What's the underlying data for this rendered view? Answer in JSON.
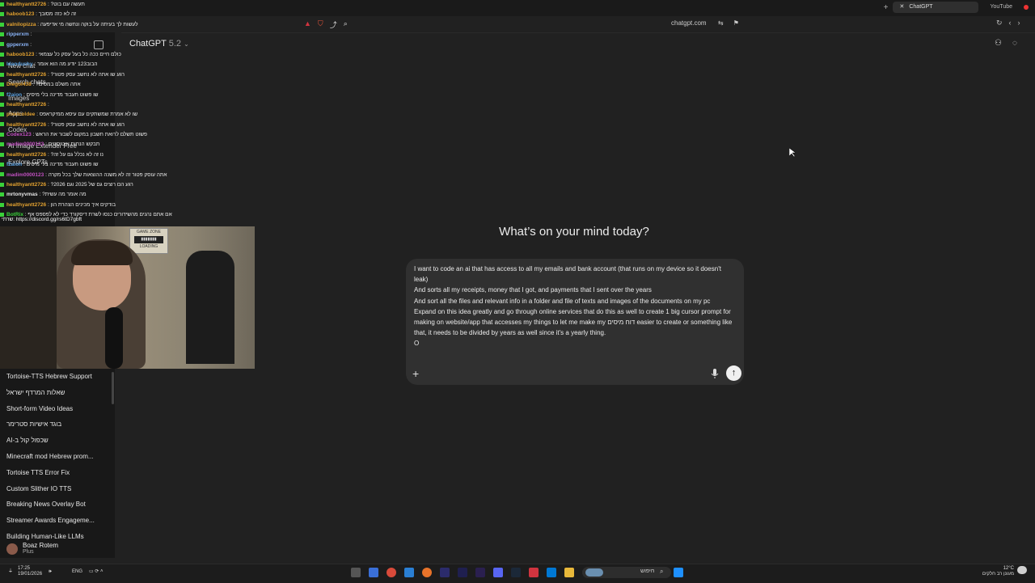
{
  "browser": {
    "tabs": [
      {
        "label": "ChatGPT",
        "active": true
      },
      {
        "label": "YouTube",
        "active": false
      }
    ],
    "url": "chatgpt.com"
  },
  "app": {
    "model_name": "ChatGPT",
    "model_version": "5.2"
  },
  "main": {
    "heading": "What’s on your mind today?",
    "composer_text": "I want to code an ai that has access to all my emails and bank account (that runs on my device so it doesn't leak)\nAnd sorts all my receipts, money that I got, and payments that I sent over the years\nAnd sort all the files and relevant info in a folder and file of texts and images of the documents on my pc\nExpand on this idea greatly and go through online services that do this as well to create 1 big cursor prompt for making on website/app that accesses my things to let me make my דוח מיסים easier to create or something like that, it needs to be divided by years as well since it's a yearly thing.\nO"
  },
  "sidebar": {
    "overlay_items": [
      "New chat",
      "Search chats",
      "Images",
      "Apps",
      "Codex",
      "AI Image Extender Free",
      "Explore GPTs"
    ],
    "chats": [
      "Tortoise-TTS Hebrew Support",
      "שאלות המרדף ישראל",
      "Short-form Video Ideas",
      "בוגד אישיות סטרימר",
      "שכפול קול ב-AI",
      "Minecraft mod Hebrew prom...",
      "Tortoise TTS Error Fix",
      "Custom Slither IO TTS",
      "Breaking News Overlay Bot",
      "Streamer Awards Engageme...",
      "Building Human-Like LLMs"
    ],
    "profile_name": "Boaz Rotem",
    "profile_plan": "Plus"
  },
  "stream_chat": {
    "lines": [
      {
        "user": "healthyantt2726",
        "msg": "?תעשה עם בוט",
        "color": "#e0a030"
      },
      {
        "user": "haboob123",
        "msg": "זה לא כזה מסובך",
        "color": "#e0a030"
      },
      {
        "user": "valnilopizza",
        "msg": "לעשות לך בעיתה על בוקה ונחשה מי אדיפעה",
        "color": "#e0a030"
      },
      {
        "user": "ripperxm",
        "msg": "",
        "color": "#8ab4f8"
      },
      {
        "user": "gpperxm",
        "msg": "",
        "color": "#8ab4f8"
      },
      {
        "user": "haboob123",
        "msg": "כולם חיים ככה כל בעל עסק כל עצמאי",
        "color": "#e0a030"
      },
      {
        "user": "Idandushy",
        "msg": "הבוב123 יודע מה הוא אומר",
        "color": "#5aa0e0"
      },
      {
        "user": "healthyantt2726",
        "msg": "?רגע שו אתה לא נחשב עסק פטור",
        "color": "#e0a030"
      },
      {
        "user": "Diegol438",
        "msg": "?אתה משלם במסים",
        "color": "#e0a030"
      },
      {
        "user": "f2aion",
        "msg": "שו פשוט תעבוד מדינה בלי מיסים",
        "color": "#5aa0e0"
      },
      {
        "user": "healthyantt2726",
        "msg": "",
        "color": "#e0a030"
      },
      {
        "user": "pixelcoldee",
        "msg": "שו לא אמרת שמשתקים עם עיסא ממיקראפס",
        "color": "#e0a030"
      },
      {
        "user": "healthyantt2726",
        "msg": "?רגע שו אתה לא נחשב עסק פטור",
        "color": "#e0a030"
      },
      {
        "user": "Codex123",
        "msg": "פשוט תשלם לרואת חשבון במקום לשבור את הראש",
        "color": "#c050c0"
      },
      {
        "user": "madim0000123",
        "msg": "תבקש הנחות אוטיסטים",
        "color": "#c050c0"
      },
      {
        "user": "healthyantt2726",
        "msg": "?נו זה לא נכלל גם על זה",
        "color": "#e0a030"
      },
      {
        "user": "f2aion",
        "msg": "שו פשוט תעבוד מדינה בלי מיסים",
        "color": "#5aa0e0"
      },
      {
        "user": "madim0000123",
        "msg": "אתה עוסק פטור זה לא משנה ההוצאות שלך בכל מקרה",
        "color": "#c050c0"
      },
      {
        "user": "healthyantt2726",
        "msg": "?רגע הם רוצים גם של 2025 וגם 2026",
        "color": "#e0a030"
      },
      {
        "user": "mrtonyvmas",
        "msg": "?מה אומר מה עשית",
        "color": "#e6e6e6"
      },
      {
        "user": "healthyantt2726",
        "msg": "בודקים איך מכינים הצהרת הון",
        "color": "#e0a030"
      },
      {
        "user": "BotRix",
        "msg": "אם אתם נהנים מהשידורים כנסו לשרת דיסקורד כדי לא לפספס אף",
        "color": "#3ad13a"
      }
    ],
    "discord_line": "שרתי: https://discord.gg/rs6tD7gbft"
  },
  "webcam": {
    "sign_text_1": "GAME ZONE",
    "sign_text_2": "LOADING"
  },
  "taskbar": {
    "time": "17:25",
    "date": "19/01/2026",
    "lang": "ENG",
    "search_label": "חיפוש",
    "weather_temp": "12°C",
    "weather_desc": "מעונן רב חלקים"
  },
  "colors": {
    "background": "#212121",
    "sidebar": "#181818",
    "composer": "#303030",
    "accent_red": "#d0343f"
  }
}
